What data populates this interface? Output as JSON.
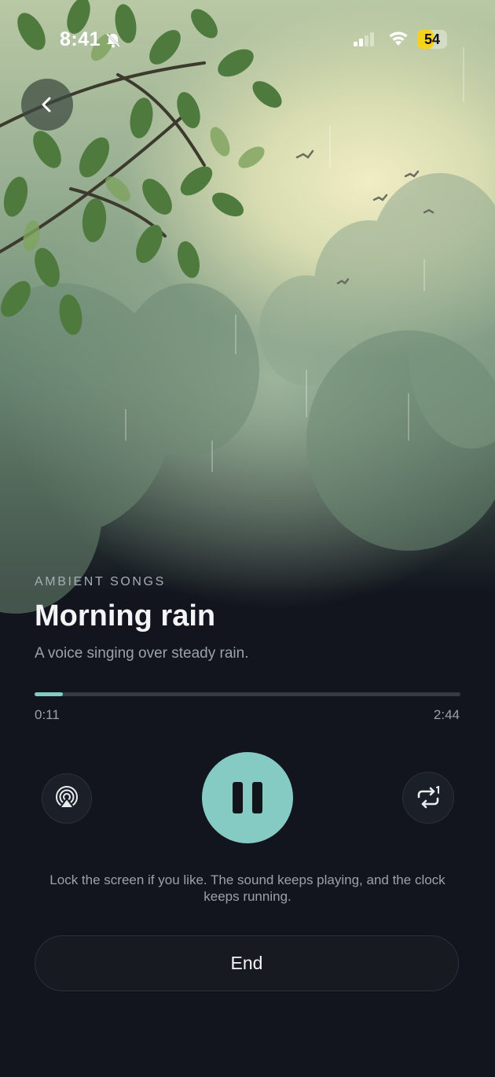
{
  "status_bar": {
    "time": "8:41",
    "battery_level": "54",
    "battery_percent": 54,
    "battery_color": "#f7d21d",
    "icons": [
      "bell-slash-icon",
      "cellular-signal-icon",
      "wifi-icon",
      "battery-icon"
    ]
  },
  "navigation": {
    "back_icon": "chevron-left-icon"
  },
  "track": {
    "category": "AMBIENT SONGS",
    "title": "Morning rain",
    "description": "A voice singing over steady rain."
  },
  "progress": {
    "elapsed": "0:11",
    "duration": "2:44",
    "fraction": 0.067
  },
  "controls": {
    "airplay_icon": "airplay-audio-icon",
    "play_pause_icon": "pause-icon",
    "repeat_icon": "repeat-one-icon"
  },
  "note": "Lock the screen if you like. The sound keeps playing, and the clock keeps running.",
  "end_button": {
    "label": "End"
  },
  "colors": {
    "accent": "#86cbc3",
    "background": "#12151d",
    "muted_text": "#9aa1ad"
  }
}
